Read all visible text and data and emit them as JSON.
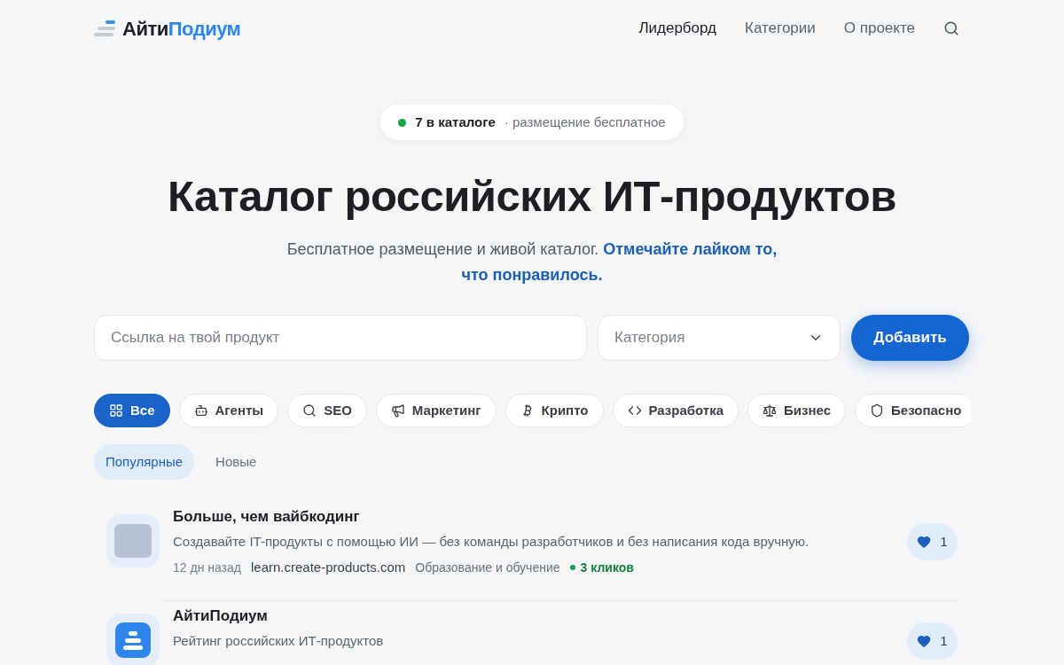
{
  "header": {
    "logo": {
      "part_1": "Айти",
      "part_2": "Подиум"
    },
    "nav": [
      {
        "label": "Лидерборд",
        "selected": true
      },
      {
        "label": "Категории",
        "selected": false
      },
      {
        "label": "О проекте",
        "selected": false
      }
    ]
  },
  "badge": {
    "count": "7 в каталоге",
    "note": "· размещение бесплатное"
  },
  "hero": {
    "title": "Каталог российских ИТ-продуктов",
    "subtitle": "Бесплатное размещение и живой каталог. **Отмечайте лайком то, что понравилось.**"
  },
  "submit_form": {
    "link_field": {
      "placeholder": "Ссылка на твой продукт"
    },
    "category_select": {
      "placeholder": "Категория"
    },
    "button": "Добавить"
  },
  "categories": [
    {
      "label": "Все",
      "selected": true
    },
    {
      "label": "Агенты",
      "selected": false
    },
    {
      "label": "SEO",
      "selected": false
    },
    {
      "label": "Маркетинг",
      "selected": false
    },
    {
      "label": "Крипто",
      "selected": false
    },
    {
      "label": "Разработка",
      "selected": false
    },
    {
      "label": "Бизнес",
      "selected": false
    },
    {
      "label": "Безопасно",
      "selected": false
    }
  ],
  "sort_tabs": [
    {
      "label": "Популярные",
      "selected": true
    },
    {
      "label": "Новые",
      "selected": false
    }
  ],
  "products": [
    {
      "kind": "photo",
      "title": "Больше, чем вайбкодинг",
      "description": "Создавайте IT-продукты с помощью ИИ — без команды разработчиков и без написания кода вручную.",
      "age": "12 дн назад",
      "site": "learn.create-products.com",
      "tags": [
        "Образование и обучение"
      ],
      "clicks": "3 кликов",
      "likes": "1"
    },
    {
      "kind": "logo",
      "title": "АйтиПодиум",
      "description": "Рейтинг российских ИТ-продуктов",
      "likes": "1"
    }
  ]
}
